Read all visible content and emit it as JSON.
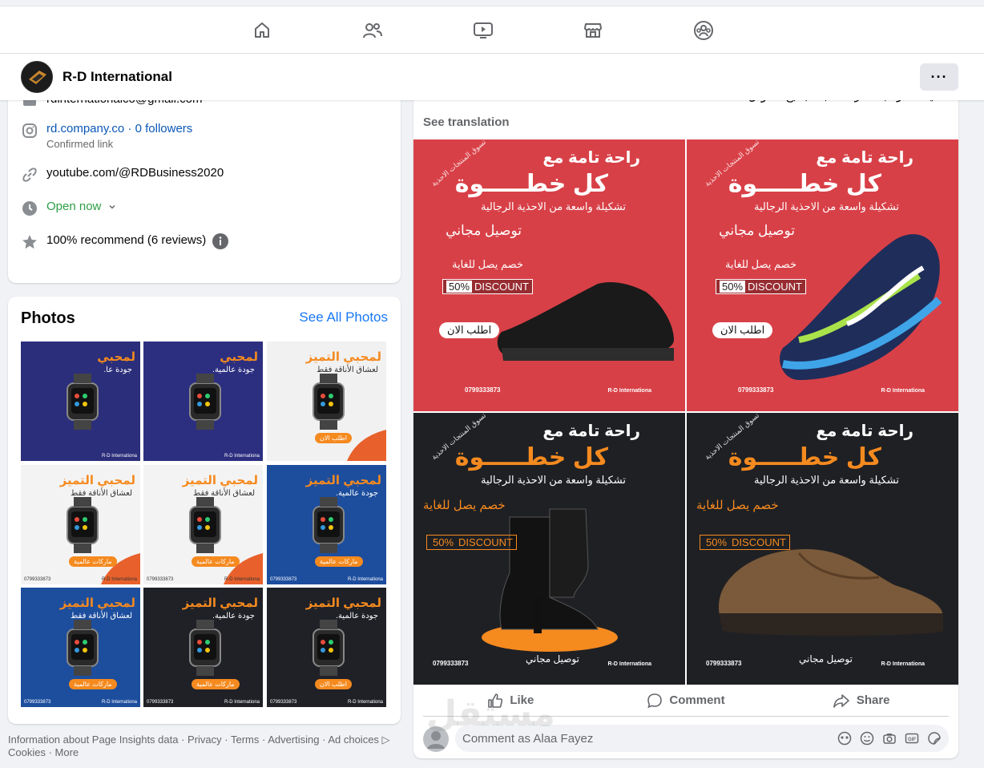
{
  "nav": {
    "icons": [
      "home-icon",
      "friends-icon",
      "watch-icon",
      "marketplace-icon",
      "groups-icon"
    ]
  },
  "page": {
    "name": "R-D International",
    "more_label": "···"
  },
  "intro": {
    "email": "rdinternationalco@gmail.com",
    "instagram": "rd.company.co · 0 followers",
    "instagram_sub": "Confirmed link",
    "youtube": "youtube.com/@RDBusiness2020",
    "hours": "Open now",
    "recommend": "100% recommend (6 reviews)"
  },
  "photos": {
    "title": "Photos",
    "see_all": "See All Photos",
    "items": [
      {
        "t1": "لمحبي",
        "t2": "جودة عا.",
        "bg": "#2b2e7a",
        "tag": "",
        "ph": "",
        "br": "R-D Internationa"
      },
      {
        "t1": "لمحبي",
        "t2": "جودة عالمية.",
        "bg": "#2c2f80",
        "tag": "",
        "ph": "",
        "br": "R-D Internationa"
      },
      {
        "t1": "لمحبي التميز",
        "t2": "لعشاق الأناقة فقط",
        "bg": "#f1f1f1",
        "tag": "اطلب الان",
        "ph": "",
        "br": ""
      },
      {
        "t1": "لمحبي التميز",
        "t2": "لعشاق الأناقة فقط",
        "bg": "#f3f3f3",
        "tag": "ماركات عالمية",
        "ph": "0799333873",
        "br": "R-D Internationa"
      },
      {
        "t1": "لمحبي التميز",
        "t2": "لعشاق الأناقة فقط",
        "bg": "#f3f3f3",
        "tag": "ماركات عالمية",
        "ph": "0799333873",
        "br": "R-D Internationa"
      },
      {
        "t1": "لمحبي التميز",
        "t2": "جودة عالمية.",
        "bg": "#1d4e9e",
        "tag": "ماركات عالمية",
        "ph": "0799333873",
        "br": "R-D Internationa"
      },
      {
        "t1": "لمحبي التميز",
        "t2": "لعشاق الأناقة فقط",
        "bg": "#1d4e9e",
        "tag": "ماركات عالمية",
        "ph": "0799333873",
        "br": "R-D Internationa"
      },
      {
        "t1": "لمحبي التميز",
        "t2": "جودة عالمية.",
        "bg": "#1f2127",
        "tag": "ماركات عالمية",
        "ph": "0799333873",
        "br": "R-D Internationa"
      },
      {
        "t1": "لمحبي التميز",
        "t2": "جودة عالمية.",
        "bg": "#1f2127",
        "tag": "اطلب الان",
        "ph": "0799333873",
        "br": "R-D Internationa"
      }
    ]
  },
  "footer": {
    "line1": "Information about Page Insights data · Privacy · Terms · Advertising · Ad choices",
    "line2": "Cookies · More"
  },
  "post": {
    "caption": "احذية فاخرة بأسعار مناسبة لجميع الأذواق - See more",
    "see_translation": "See translation",
    "ads": [
      {
        "style": "red",
        "l1": "راحة تامة مع",
        "l2": "كل خطـــــوة",
        "l3": "تشكيلة واسعة من الاحذية الرجالية",
        "l4": "توصيل مجاني",
        "l5": "خصم يصل للغاية",
        "disc_pct": "50%",
        "disc": "DISCOUNT",
        "order": "اطلب الان",
        "side": "تسوق المنتجات الاحذية",
        "phone": "0799333873",
        "brand": "R-D Internationa"
      },
      {
        "style": "red",
        "l1": "راحة تامة مع",
        "l2": "كل خطـــــوة",
        "l3": "تشكيلة واسعة من الاحذية الرجالية",
        "l4": "توصيل مجاني",
        "l5": "خصم يصل للغاية",
        "disc_pct": "50%",
        "disc": "DISCOUNT",
        "order": "اطلب الان",
        "side": "تسوق المنتجات الاحذية",
        "phone": "0799333873",
        "brand": "R-D Internationa"
      },
      {
        "style": "dark",
        "l1": "راحة تامة مع",
        "l2": "كل خطـــــوة",
        "l3": "تشكيلة واسعة من الاحذية الرجالية",
        "l4": "خصم يصل للغاية",
        "disc_pct": "50%",
        "disc": "DISCOUNT",
        "deliver": "توصيل مجاني",
        "side": "تسوق المنتجات الاحذية",
        "phone": "0799333873",
        "brand": "R-D Internationa"
      },
      {
        "style": "dark",
        "l1": "راحة تامة مع",
        "l2": "كل خطـــــوة",
        "l3": "تشكيلة واسعة من الاحذية الرجالية",
        "l4": "خصم يصل للغاية",
        "disc_pct": "50%",
        "disc": "DISCOUNT",
        "deliver": "توصيل مجاني",
        "side": "تسوق المنتجات الاحذية",
        "phone": "0799333873",
        "brand": "R-D Internationa"
      }
    ],
    "like": "Like",
    "comment": "Comment",
    "share": "Share",
    "comment_placeholder": "Comment as Alaa Fayez"
  },
  "watermark": "مستقل"
}
